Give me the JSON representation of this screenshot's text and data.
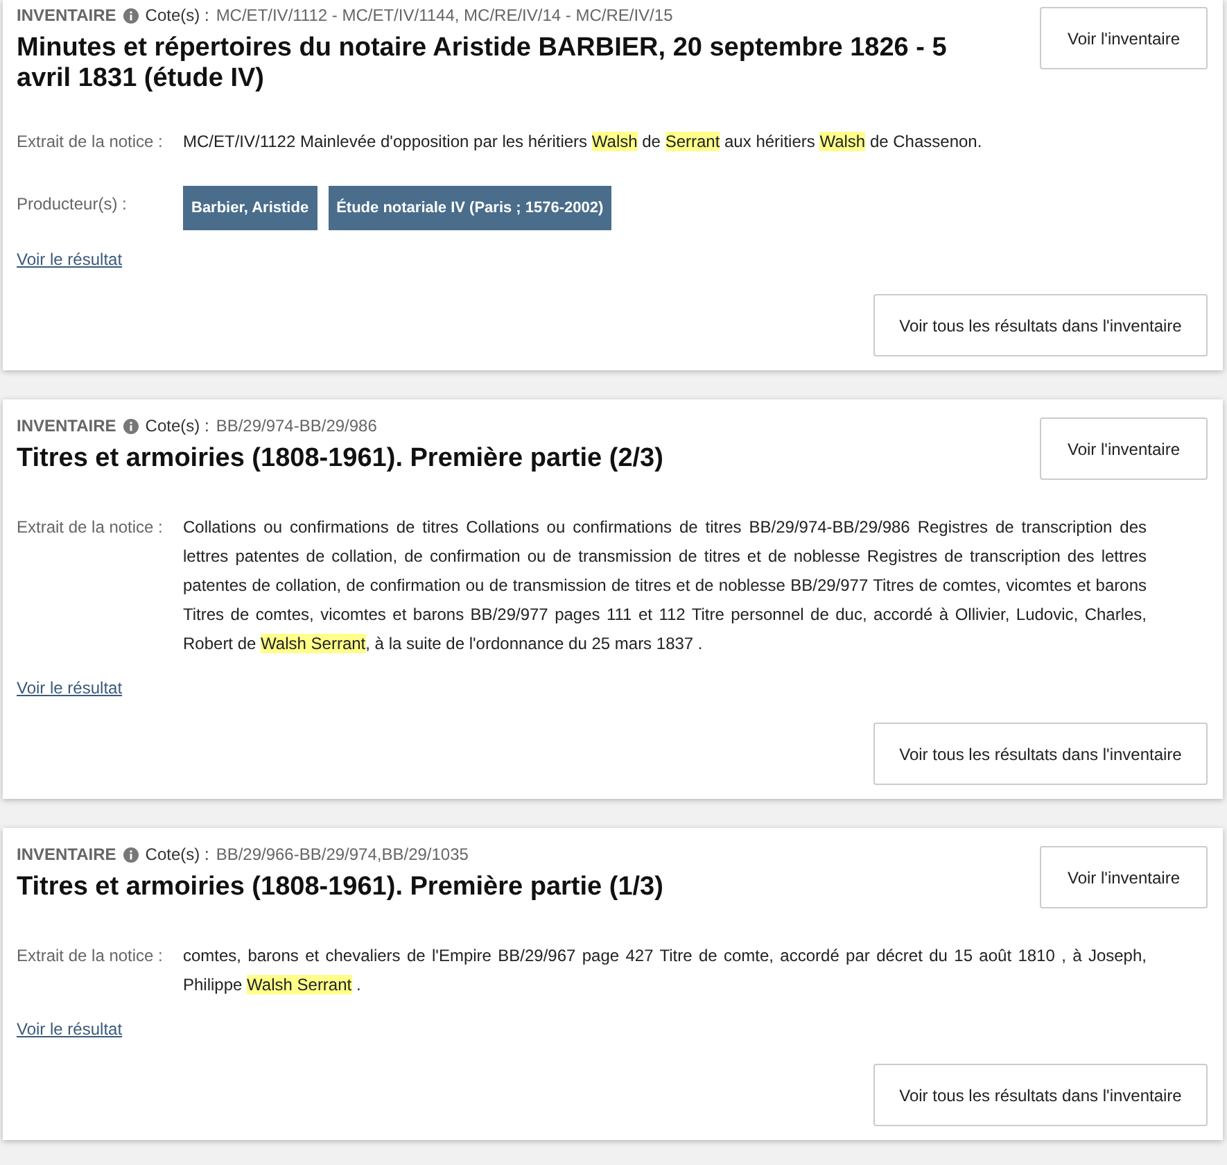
{
  "results": [
    {
      "type_label": "INVENTAIRE",
      "cote_label": "Cote(s) :",
      "cote": "MC/ET/IV/1112 - MC/ET/IV/1144, MC/RE/IV/14 - MC/RE/IV/15",
      "title": "Minutes et répertoires du notaire Aristide BARBIER, 20 septembre 1826 - 5 avril 1831 (étude IV)",
      "open_button": "Voir l'inventaire",
      "extract_label": "Extrait de la notice :",
      "extract": [
        {
          "text": "MC/ET/IV/1122 Mainlevée d'opposition par les héritiers ",
          "highlight": false
        },
        {
          "text": "Walsh",
          "highlight": true
        },
        {
          "text": " de ",
          "highlight": false
        },
        {
          "text": "Serrant",
          "highlight": true
        },
        {
          "text": " aux héritiers ",
          "highlight": false
        },
        {
          "text": "Walsh",
          "highlight": true
        },
        {
          "text": " de Chassenon.",
          "highlight": false
        }
      ],
      "producers_label": "Producteur(s) :",
      "producers": [
        "Barbier, Aristide",
        "Étude notariale IV (Paris ; 1576-2002)"
      ],
      "result_link": "Voir le résultat",
      "all_results_button": "Voir tous les résultats dans l'inventaire"
    },
    {
      "type_label": "INVENTAIRE",
      "cote_label": "Cote(s) :",
      "cote": "BB/29/974-BB/29/986",
      "title": "Titres et armoiries (1808-1961). Première partie (2/3)",
      "open_button": "Voir l'inventaire",
      "extract_label": "Extrait de la notice :",
      "extract": [
        {
          "text": "Collations ou confirmations de titres Collations ou confirmations de titres BB/29/974-BB/29/986 Registres de transcription des lettres patentes de collation, de confirmation ou de transmission de titres et de noblesse Registres de transcription des lettres patentes de collation, de confirmation ou de transmission de titres et de noblesse BB/29/977 Titres de comtes, vicomtes et barons Titres de comtes, vicomtes et barons BB/29/977 pages 111 et 112 Titre personnel de duc, accordé à Ollivier, Ludovic, Charles, Robert de ",
          "highlight": false
        },
        {
          "text": "Walsh Serrant",
          "highlight": true
        },
        {
          "text": ", à la suite de l'ordonnance du 25 mars 1837 .",
          "highlight": false
        }
      ],
      "result_link": "Voir le résultat",
      "all_results_button": "Voir tous les résultats dans l'inventaire"
    },
    {
      "type_label": "INVENTAIRE",
      "cote_label": "Cote(s) :",
      "cote": "BB/29/966-BB/29/974,BB/29/1035",
      "title": "Titres et armoiries (1808-1961). Première partie (1/3)",
      "open_button": "Voir l'inventaire",
      "extract_label": "Extrait de la notice :",
      "extract": [
        {
          "text": "comtes, barons et chevaliers de l'Empire BB/29/967 page 427 Titre de comte, accordé par décret du 15 août 1810 , à Joseph, Philippe ",
          "highlight": false
        },
        {
          "text": "Walsh Serrant",
          "highlight": true
        },
        {
          "text": " .",
          "highlight": false
        }
      ],
      "result_link": "Voir le résultat",
      "all_results_button": "Voir tous les résultats dans l'inventaire"
    }
  ]
}
